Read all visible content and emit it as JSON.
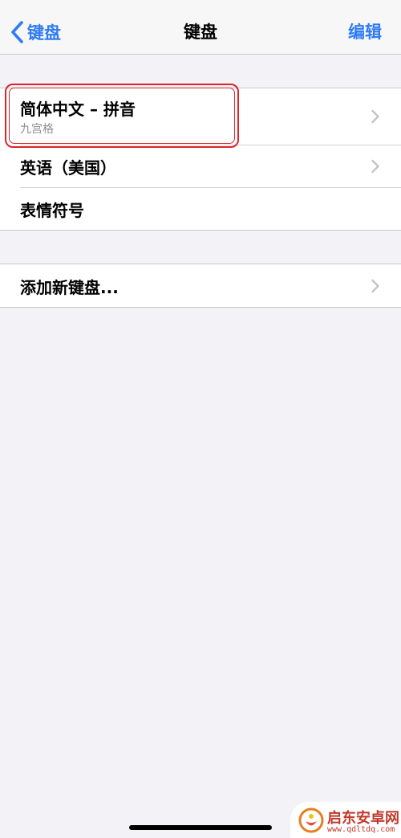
{
  "navbar": {
    "back_label": "键盘",
    "title": "键盘",
    "edit_label": "编辑"
  },
  "keyboards": [
    {
      "title": "简体中文 – 拼音",
      "subtitle": "九宫格",
      "has_chevron": true
    },
    {
      "title": "英语（美国）",
      "has_chevron": true
    },
    {
      "title": "表情符号",
      "has_chevron": false
    }
  ],
  "add_keyboard": {
    "label": "添加新键盘..."
  },
  "watermark": {
    "name": "启东安卓网",
    "url": "www.qdltdq.com"
  },
  "colors": {
    "accent": "#2f7bf5",
    "highlight": "#d9262c",
    "background": "#f2f2f7",
    "secondary_text": "#8e8e93",
    "chevron": "#c4c4c7"
  }
}
